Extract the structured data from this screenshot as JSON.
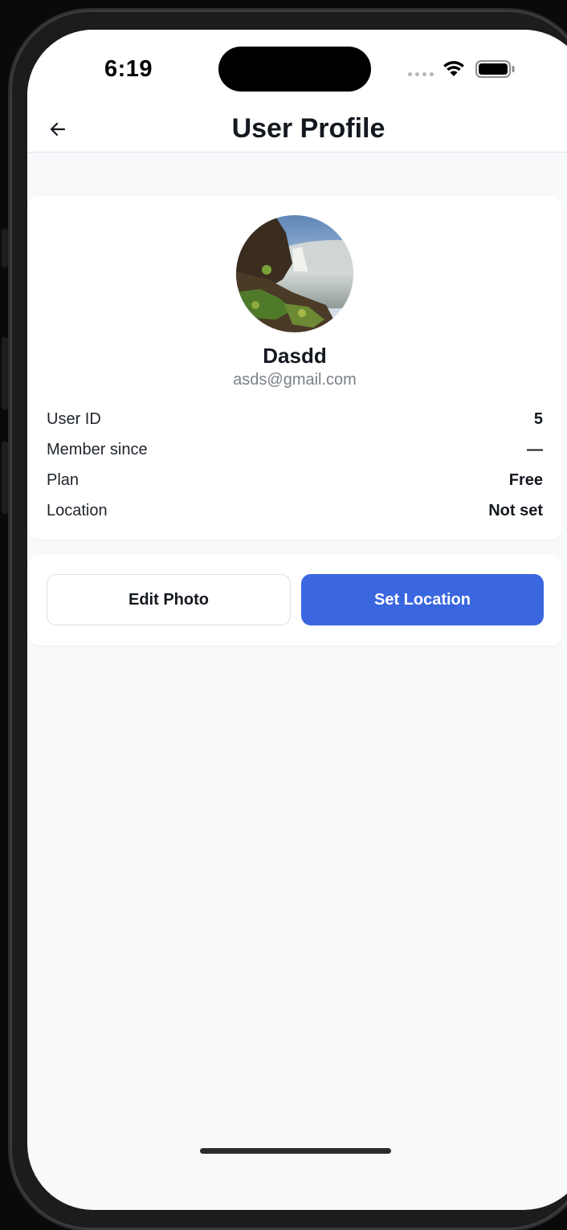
{
  "status": {
    "time": "6:19"
  },
  "header": {
    "title": "User Profile"
  },
  "profile": {
    "name": "Dasdd",
    "email": "asds@gmail.com",
    "info": [
      {
        "label": "User ID",
        "value": "5"
      },
      {
        "label": "Member since",
        "value": "—"
      },
      {
        "label": "Plan",
        "value": "Free"
      },
      {
        "label": "Location",
        "value": "Not set"
      }
    ]
  },
  "actions": {
    "edit_photo": "Edit Photo",
    "set_location": "Set Location"
  },
  "colors": {
    "accent": "#3a66e0",
    "background": "#f8f9fb",
    "card": "#ffffff",
    "text": "#14181f",
    "muted": "#7a7f88"
  },
  "icons": {
    "back": "arrow-left-icon",
    "wifi": "wifi-icon",
    "battery": "battery-icon",
    "signal": "cellular-signal-icon"
  }
}
